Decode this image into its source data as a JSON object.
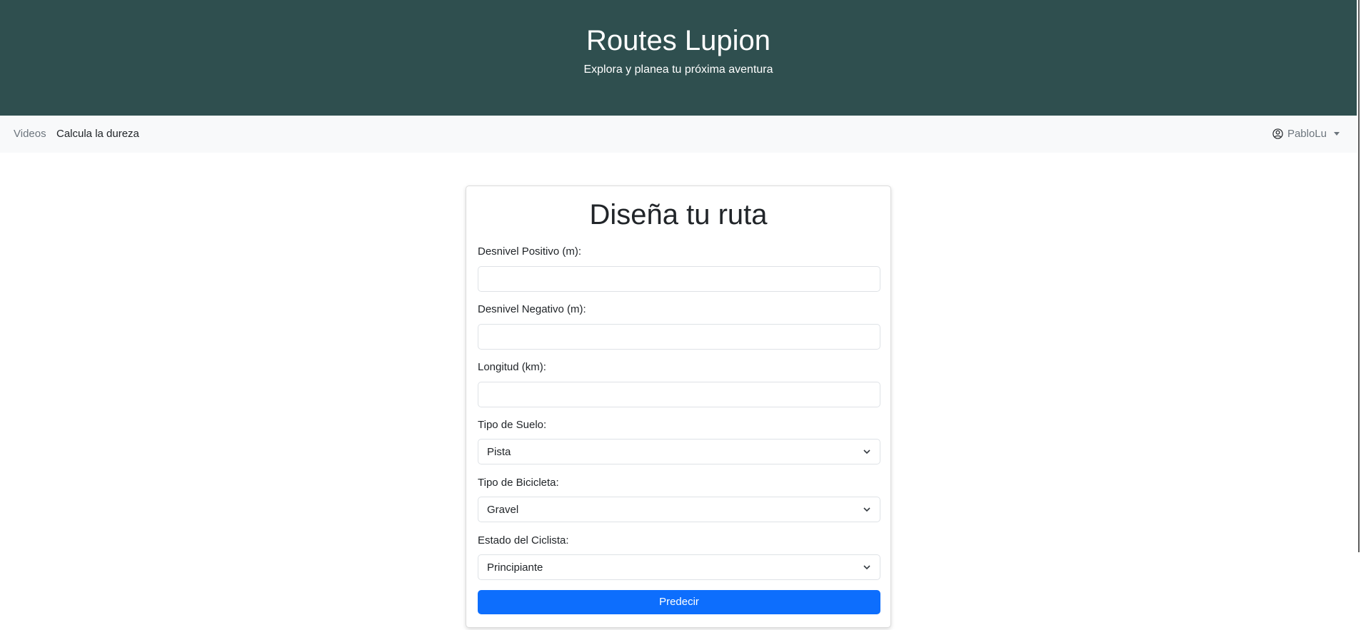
{
  "header": {
    "title": "Routes Lupion",
    "subtitle": "Explora y planea tu próxima aventura"
  },
  "navbar": {
    "links": [
      "Videos",
      "Calcula la dureza"
    ],
    "user": {
      "name": "PabloLu",
      "icon": "user-circle-icon"
    }
  },
  "form": {
    "title": "Diseña tu ruta",
    "fields": [
      {
        "label": "Desnivel Positivo (m):",
        "value": "",
        "type": "number"
      },
      {
        "label": "Desnivel Negativo (m):",
        "value": "",
        "type": "number"
      },
      {
        "label": "Longitud (km):",
        "value": "",
        "type": "number"
      },
      {
        "label": "Tipo de Suelo:",
        "value": "Pista",
        "type": "select"
      },
      {
        "label": "Tipo de Bicicleta:",
        "value": "Gravel",
        "type": "select"
      },
      {
        "label": "Estado del Ciclista:",
        "value": "Principiante",
        "type": "select"
      }
    ],
    "submit_label": "Predecir"
  },
  "colors": {
    "header_bg": "#2f4f4f",
    "navbar_bg": "#f8f9fa",
    "button_primary": "#0d6efd"
  }
}
